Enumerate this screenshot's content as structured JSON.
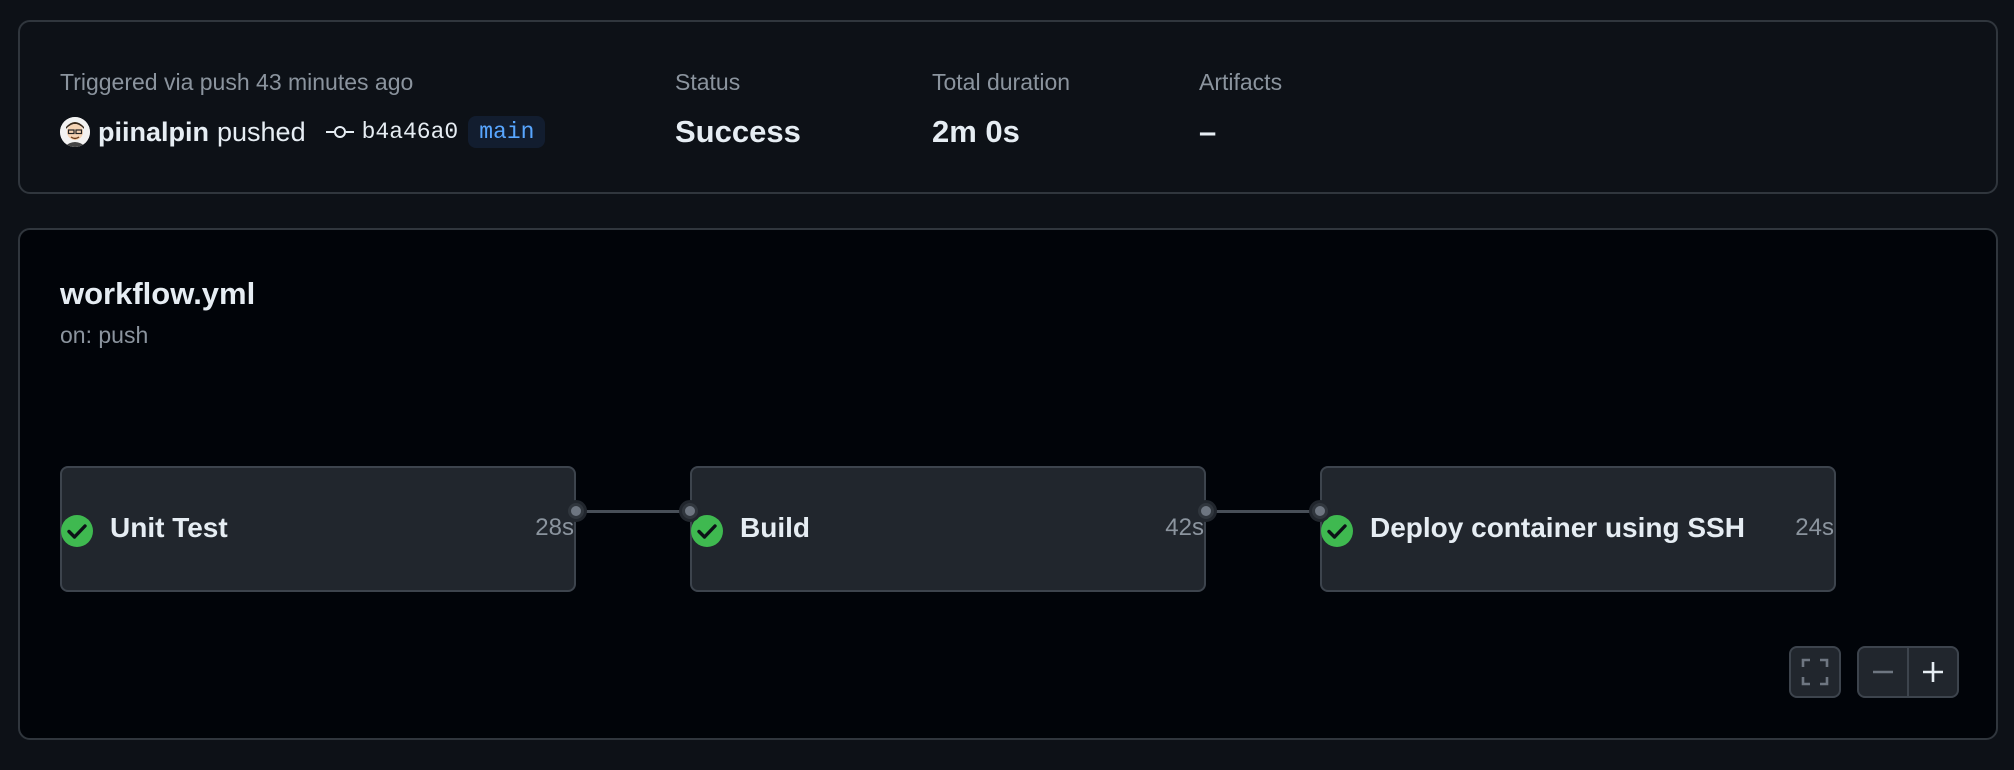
{
  "summary": {
    "trigger_text": "Triggered via push 43 minutes ago",
    "actor": "piinalpin",
    "action": "pushed",
    "commit_sha": "b4a46a0",
    "branch": "main",
    "status_label": "Status",
    "status_value": "Success",
    "duration_label": "Total duration",
    "duration_value": "2m 0s",
    "artifacts_label": "Artifacts",
    "artifacts_value": "–"
  },
  "workflow": {
    "file": "workflow.yml",
    "trigger": "on: push"
  },
  "jobs": [
    {
      "name": "Unit Test",
      "duration": "28s",
      "status": "success"
    },
    {
      "name": "Build",
      "duration": "42s",
      "status": "success"
    },
    {
      "name": "Deploy container using SSH",
      "duration": "24s",
      "status": "success"
    }
  ],
  "icons": {
    "avatar": "avatar-icon",
    "commit": "git-commit-icon",
    "success": "check-circle-fill-icon",
    "fullscreen": "fullscreen-icon",
    "zoom_out": "minus-icon",
    "zoom_in": "plus-icon"
  },
  "colors": {
    "success": "#3fb950",
    "branch": "#58a6ff",
    "background": "#0d1117"
  }
}
